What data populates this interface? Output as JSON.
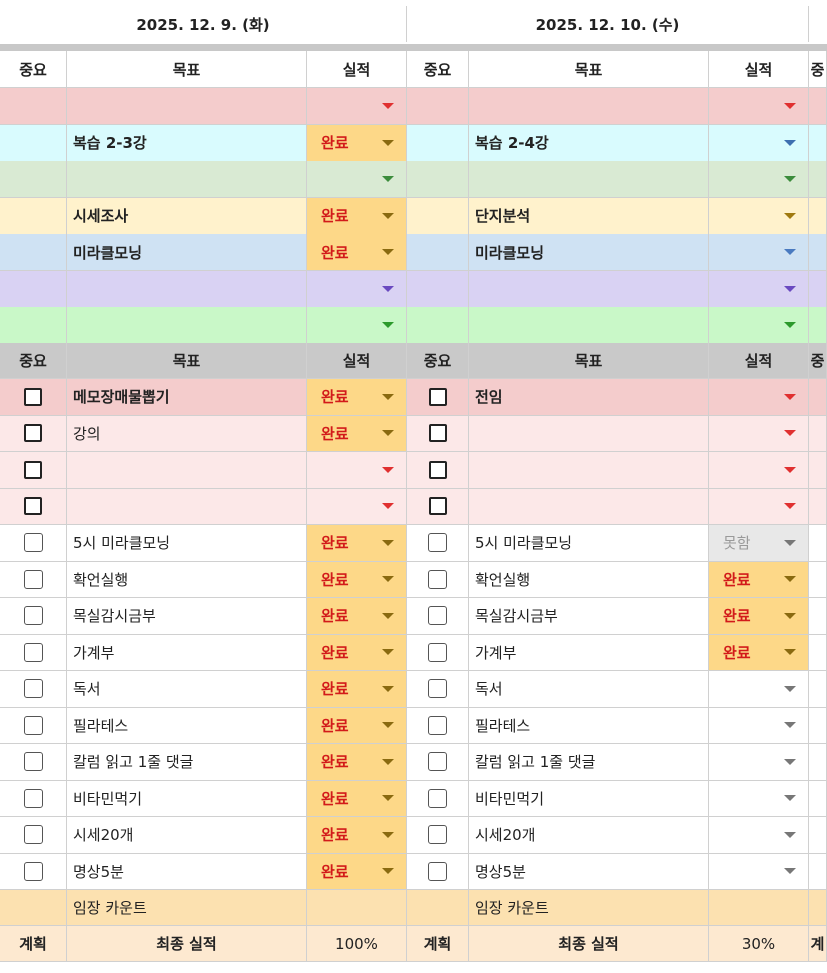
{
  "dates": [
    "2025. 12. 9. (화)",
    "2025. 12. 10. (수)"
  ],
  "headers": {
    "importance": "중요",
    "goal": "목표",
    "result": "실적",
    "next_partial": "중"
  },
  "colors": {
    "red_row": "#f4cccc",
    "cyan_row": "#d9fbfe",
    "green_row": "#d9ead3",
    "yellow_row": "#fff2cc",
    "blue_row": "#cfe2f3",
    "purple_row": "#d9d2f3",
    "lightgreen_row": "#c9f8c8",
    "pink_row": "#fce8e8",
    "gray_header": "#c9c9c9",
    "done_fill": "#fdd888",
    "done_text": "#d21a1a",
    "summary_fill": "#fce1b0"
  },
  "top_section": [
    {
      "color": "red",
      "arrow": "#e03030",
      "left": {
        "goal": "",
        "result": ""
      },
      "right": {
        "goal": "",
        "result": ""
      }
    },
    {
      "color": "cyan",
      "arrow": "#3d6fb0",
      "left": {
        "goal": "복습 2-3강",
        "result": "완료"
      },
      "right": {
        "goal": "복습 2-4강",
        "result": ""
      }
    },
    {
      "color": "green",
      "arrow": "#3c8c3c",
      "left": {
        "goal": "",
        "result": ""
      },
      "right": {
        "goal": "",
        "result": ""
      }
    },
    {
      "color": "yellow",
      "arrow": "#a07a10",
      "left": {
        "goal": "시세조사",
        "result": "완료"
      },
      "right": {
        "goal": "단지분석",
        "result": ""
      }
    },
    {
      "color": "blue",
      "arrow": "#4a7ac0",
      "left": {
        "goal": "미라클모닝",
        "result": "완료"
      },
      "right": {
        "goal": "미라클모닝",
        "result": ""
      }
    },
    {
      "color": "purple",
      "arrow": "#6a4ac0",
      "left": {
        "goal": "",
        "result": ""
      },
      "right": {
        "goal": "",
        "result": ""
      }
    },
    {
      "color": "lightgreen",
      "arrow": "#2c9a2c",
      "left": {
        "goal": "",
        "result": ""
      },
      "right": {
        "goal": "",
        "result": ""
      }
    }
  ],
  "task_section": [
    {
      "color": "red",
      "bold": true,
      "left": {
        "goal": "메모장매물뽑기",
        "result": "완료"
      },
      "right": {
        "goal": "전임",
        "result": ""
      }
    },
    {
      "color": "pink",
      "bold": false,
      "left": {
        "goal": "강의",
        "result": "완료"
      },
      "right": {
        "goal": "",
        "result": ""
      }
    },
    {
      "color": "pink",
      "bold": false,
      "left": {
        "goal": "",
        "result": ""
      },
      "right": {
        "goal": "",
        "result": ""
      }
    },
    {
      "color": "pink",
      "bold": false,
      "left": {
        "goal": "",
        "result": ""
      },
      "right": {
        "goal": "",
        "result": ""
      }
    }
  ],
  "routine_section": [
    {
      "left": {
        "goal": "5시 미라클모닝",
        "result": "완료"
      },
      "right": {
        "goal": "5시 미라클모닝",
        "result": "못함"
      }
    },
    {
      "left": {
        "goal": "확언실행",
        "result": "완료"
      },
      "right": {
        "goal": "확언실행",
        "result": "완료"
      }
    },
    {
      "left": {
        "goal": "목실감시금부",
        "result": "완료"
      },
      "right": {
        "goal": "목실감시금부",
        "result": "완료"
      }
    },
    {
      "left": {
        "goal": "가계부",
        "result": "완료"
      },
      "right": {
        "goal": "가계부",
        "result": "완료"
      }
    },
    {
      "left": {
        "goal": "독서",
        "result": "완료"
      },
      "right": {
        "goal": "독서",
        "result": ""
      }
    },
    {
      "left": {
        "goal": "필라테스",
        "result": "완료"
      },
      "right": {
        "goal": "필라테스",
        "result": ""
      }
    },
    {
      "left": {
        "goal": "칼럼 읽고 1줄 댓글",
        "result": "완료"
      },
      "right": {
        "goal": "칼럼 읽고 1줄 댓글",
        "result": ""
      }
    },
    {
      "left": {
        "goal": "비타민먹기",
        "result": "완료"
      },
      "right": {
        "goal": "비타민먹기",
        "result": ""
      }
    },
    {
      "left": {
        "goal": "시세20개",
        "result": "완료"
      },
      "right": {
        "goal": "시세20개",
        "result": ""
      }
    },
    {
      "left": {
        "goal": "명상5분",
        "result": "완료"
      },
      "right": {
        "goal": "명상5분",
        "result": ""
      }
    }
  ],
  "count_row": {
    "left": "임장 카운트",
    "right": "임장 카운트"
  },
  "summary_row": {
    "plan": "계획",
    "final_label": "최종 실적",
    "left_pct": "100%",
    "right_pct": "30%",
    "next_partial": "계"
  }
}
